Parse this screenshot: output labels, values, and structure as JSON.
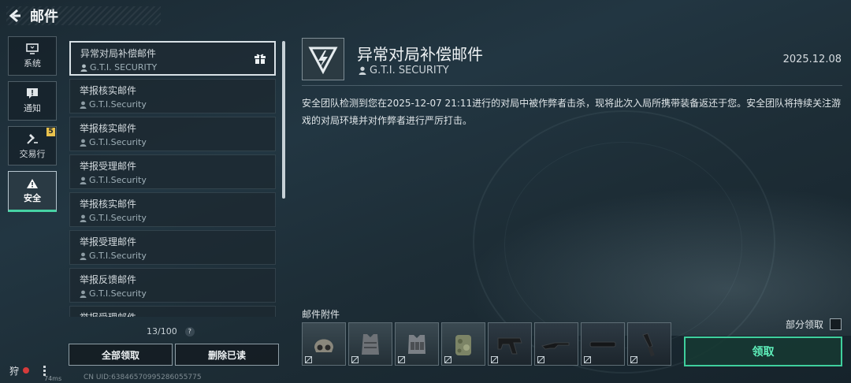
{
  "header": {
    "title": "邮件"
  },
  "sidebar": {
    "items": [
      {
        "label": "系统",
        "icon": "monitor-icon",
        "active": false,
        "badge": ""
      },
      {
        "label": "通知",
        "icon": "alert-message-icon",
        "active": false,
        "badge": ""
      },
      {
        "label": "交易行",
        "icon": "hammer-icon",
        "active": false,
        "badge": "5"
      },
      {
        "label": "安全",
        "icon": "warning-icon",
        "active": true,
        "badge": ""
      }
    ]
  },
  "mail_list": {
    "items": [
      {
        "title": "异常对局补偿邮件",
        "sender": "G.T.I. SECURITY",
        "selected": true
      },
      {
        "title": "举报核实邮件",
        "sender": "G.T.I.Security",
        "selected": false
      },
      {
        "title": "举报核实邮件",
        "sender": "G.T.I.Security",
        "selected": false
      },
      {
        "title": "举报受理邮件",
        "sender": "G.T.I.Security",
        "selected": false
      },
      {
        "title": "举报核实邮件",
        "sender": "G.T.I.Security",
        "selected": false
      },
      {
        "title": "举报受理邮件",
        "sender": "G.T.I.Security",
        "selected": false
      },
      {
        "title": "举报反馈邮件",
        "sender": "G.T.I.Security",
        "selected": false
      },
      {
        "title": "举报受理邮件",
        "sender": "",
        "selected": false
      }
    ],
    "count": "13/100",
    "help": "?",
    "claim_all_label": "全部领取",
    "delete_read_label": "删除已读"
  },
  "footer": {
    "uid": "CN UID:63846570995286055775",
    "hunter": "狩",
    "ping": "74ms"
  },
  "detail": {
    "title": "异常对局补偿邮件",
    "sender": "G.T.I. SECURITY",
    "date": "2025.12.08",
    "body": "安全团队检测到您在2025-12-07 21:11进行的对局中被作弊者击杀，现将此次入局所携带装备返还于您。安全团队将持续关注游戏的对局环境并对作弊者进行严厉打击。",
    "attachments_label": "邮件附件",
    "attachments": [
      {
        "name": "tactical-helmet-icon"
      },
      {
        "name": "body-armor-icon"
      },
      {
        "name": "chest-rig-icon"
      },
      {
        "name": "camo-backpack-icon"
      },
      {
        "name": "smg-icon"
      },
      {
        "name": "rifle-icon"
      },
      {
        "name": "suppressor-icon"
      },
      {
        "name": "knife-icon"
      }
    ],
    "partial_claim_label": "部分领取",
    "claim_label": "领取"
  },
  "colors": {
    "accent": "#46d3a4",
    "badge": "#e9c24d",
    "claim_text": "#5ff0bb"
  }
}
